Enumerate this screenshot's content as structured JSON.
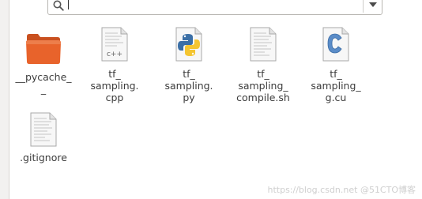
{
  "search": {
    "value": "",
    "placeholder": ""
  },
  "files": [
    {
      "name": "pycache-folder",
      "label_lines": [
        "__pycache_",
        "_"
      ],
      "icon": "folder-icon"
    },
    {
      "name": "tf-sampling-cpp",
      "label_lines": [
        "tf_",
        "sampling.",
        "cpp"
      ],
      "icon": "cpp-file-icon",
      "icon_text": "c++"
    },
    {
      "name": "tf-sampling-py",
      "label_lines": [
        "tf_",
        "sampling.",
        "py"
      ],
      "icon": "python-file-icon"
    },
    {
      "name": "tf-sampling-compile-sh",
      "label_lines": [
        "tf_",
        "sampling_",
        "compile.sh"
      ],
      "icon": "text-file-icon"
    },
    {
      "name": "tf-sampling-g-cu",
      "label_lines": [
        "tf_",
        "sampling_",
        "g.cu"
      ],
      "icon": "c-source-file-icon"
    },
    {
      "name": "gitignore",
      "label_lines": [
        ".gitignore"
      ],
      "icon": "text-file-icon"
    }
  ],
  "watermark": "https://blog.csdn.net @51CTO博客",
  "colors": {
    "folder": "#e8632b",
    "folder_dark": "#c9501f",
    "c_blue": "#5a8cc8"
  }
}
